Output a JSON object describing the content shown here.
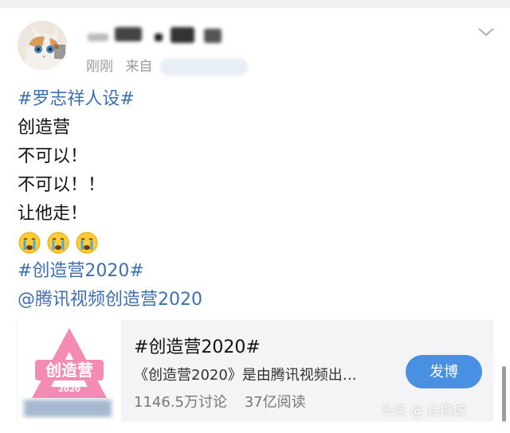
{
  "post": {
    "time": "刚刚",
    "source_prefix": "来自",
    "lines": {
      "topic1": "#罗志祥人设#",
      "l1": "创造营",
      "l2": "不可以！",
      "l3": "不可以！！",
      "l4": "让他走！",
      "topic2": "#创造营2020#",
      "mention": "@腾讯视频创造营2020"
    },
    "emojis": [
      "crying-face",
      "crying-face",
      "crying-face"
    ]
  },
  "card": {
    "title": "#创造营2020#",
    "description": "《创造营2020》是由腾讯视频出…",
    "discussions": "1146.5万讨论",
    "reads": "37亿阅读",
    "button": "发博",
    "logo_text": "创造营",
    "logo_year": "2020"
  },
  "watermark": "头条 @ 杜梅城",
  "colors": {
    "link": "#3b6fb2",
    "button": "#4a90e2",
    "logo_pink": "#f48bb4"
  }
}
